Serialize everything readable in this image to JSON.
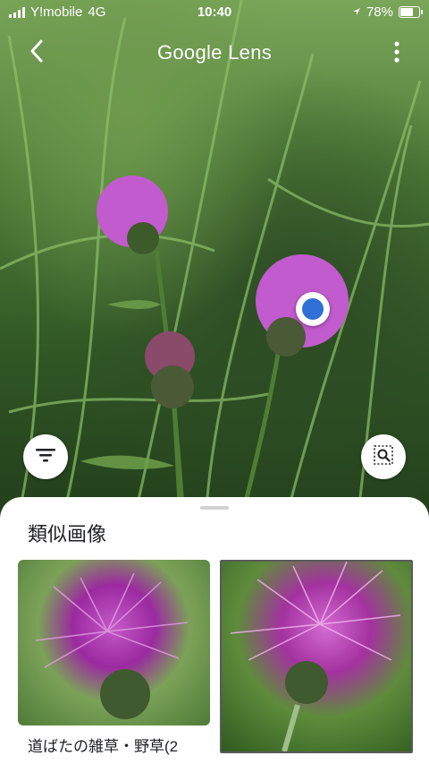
{
  "status_bar": {
    "carrier": "Y!mobile",
    "network": "4G",
    "time": "10:40",
    "battery_text": "78%",
    "battery_level": 0.78
  },
  "header": {
    "title": "Google Lens"
  },
  "icons": {
    "back": "back-arrow-icon",
    "more": "more-vert-icon",
    "filter": "filter-icon",
    "search_region": "image-search-icon",
    "location": "location-arrow-icon"
  },
  "colors": {
    "accent": "#2f6fd6",
    "sheet_bg": "#ffffff",
    "text": "#202124"
  },
  "results": {
    "heading": "類似画像",
    "items": [
      {
        "caption": "道ばたの雑草・野草(2"
      },
      {
        "caption": ""
      }
    ]
  }
}
